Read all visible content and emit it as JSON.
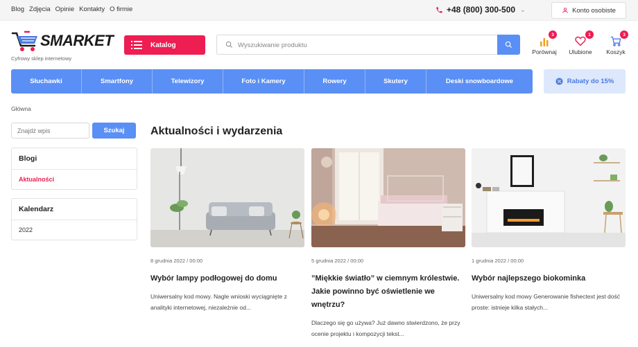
{
  "topbar": {
    "links": [
      "Blog",
      "Zdjęcia",
      "Opinie",
      "Kontakty",
      "O firmie"
    ],
    "phone": "+48 (800) 300-500",
    "account_label": "Konto osobiste"
  },
  "header": {
    "logo_text": "SMARKET",
    "logo_subtitle": "Cyfrowy sklep internetowy",
    "catalog_label": "Katalog",
    "search_placeholder": "Wyszukiwanie produktu",
    "icons": [
      {
        "label": "Porównaj",
        "badge": "3",
        "icon": "compare-icon"
      },
      {
        "label": "Ulubione",
        "badge": "1",
        "icon": "heart-icon"
      },
      {
        "label": "Koszyk",
        "badge": "3",
        "icon": "cart-icon"
      }
    ]
  },
  "categories": [
    "Słuchawki",
    "Smartfony",
    "Telewizory",
    "Foto i Kamery",
    "Rowery",
    "Skutery",
    "Deski snowboardowe"
  ],
  "promo": {
    "label": "Rabaty do 15%",
    "icon": "discount-icon"
  },
  "breadcrumb": "Główna",
  "sidebar": {
    "search_placeholder": "Znajdź wpis",
    "search_button": "Szukaj",
    "blogs": {
      "title": "Blogi",
      "items": [
        "Aktualności"
      ]
    },
    "calendar": {
      "title": "Kalendarz",
      "items": [
        "2022"
      ]
    }
  },
  "main": {
    "title": "Aktualności i wydarzenia",
    "posts": [
      {
        "date": "8 grudnia 2022 / 00:00",
        "title": "Wybór lampy podłogowej do domu",
        "excerpt": "Uniwersalny kod mowy. Nagle wnioski wyciągnięte z analityki internetowej, niezależnie od..."
      },
      {
        "date": "5 grudnia 2022 / 00:00",
        "title": "”Miękkie światło” w ciemnym królestwie. Jakie powinno być oświetlenie we wnętrzu?",
        "excerpt": "Dlaczego się go używa? Już dawno stwierdzono, że przy ocenie projektu i kompozycji tekst..."
      },
      {
        "date": "1 grudnia 2022 / 00:00",
        "title": "Wybór najlepszego biokominka",
        "excerpt": "Uniwersalny kod mowy Generowanie fishectext jest dość proste: istnieje kilka stałych..."
      }
    ]
  },
  "colors": {
    "accent_red": "#ee1d52",
    "accent_blue": "#5a8ff5",
    "promo_bg": "#dde8fc"
  }
}
